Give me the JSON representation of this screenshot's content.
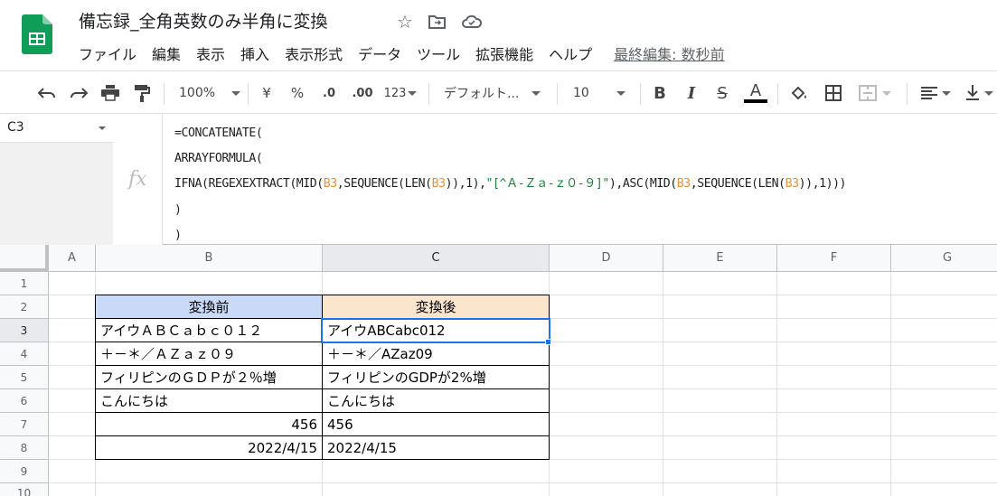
{
  "title_bar": {
    "doc_title": "備忘録_全角英数のみ半角に変換",
    "icons": [
      "star-icon",
      "move-to-folder-icon",
      "cloud-status-icon"
    ]
  },
  "menu": {
    "items": [
      "ファイル",
      "編集",
      "表示",
      "挿入",
      "表示形式",
      "データ",
      "ツール",
      "拡張機能",
      "ヘルプ"
    ],
    "last_edit": "最終編集: 数秒前"
  },
  "toolbar": {
    "zoom": "100%",
    "currency": "¥",
    "percent": "%",
    "decrease_decimal": ".0",
    "increase_decimal": ".00",
    "more_formats": "123",
    "font": "デフォルト...",
    "font_size": "10",
    "bold": "B",
    "italic": "I",
    "strikethrough": "S",
    "text_color": "A"
  },
  "formula_bar": {
    "cell_ref": "C3",
    "fx": "fx"
  },
  "grid": {
    "columns": [
      "A",
      "B",
      "C",
      "D",
      "E",
      "F",
      "G"
    ],
    "rows": [
      "1",
      "2",
      "3",
      "4",
      "5",
      "6",
      "7",
      "8",
      "9",
      "10"
    ],
    "active_column": "C",
    "active_row": "3",
    "header_colors": {
      "before": "#c9daf8",
      "after": "#fce5cd"
    },
    "table": {
      "header_before": "変換前",
      "header_after": "変換後",
      "rows": [
        {
          "before": "アイウＡＢＣａｂｃ０１２",
          "after": "アイウABCabc012"
        },
        {
          "before": "＋－＊／ＡＺａｚ０９",
          "after": "＋－＊／AZaz09"
        },
        {
          "before": "フィリピンのＧＤＰが２％増",
          "after": "フィリピンのGDPが2%増"
        },
        {
          "before": "こんにちは",
          "after": "こんにちは"
        },
        {
          "before": "456",
          "after": "456"
        },
        {
          "before": "2022/4/15",
          "after": "2022/4/15"
        }
      ]
    }
  }
}
